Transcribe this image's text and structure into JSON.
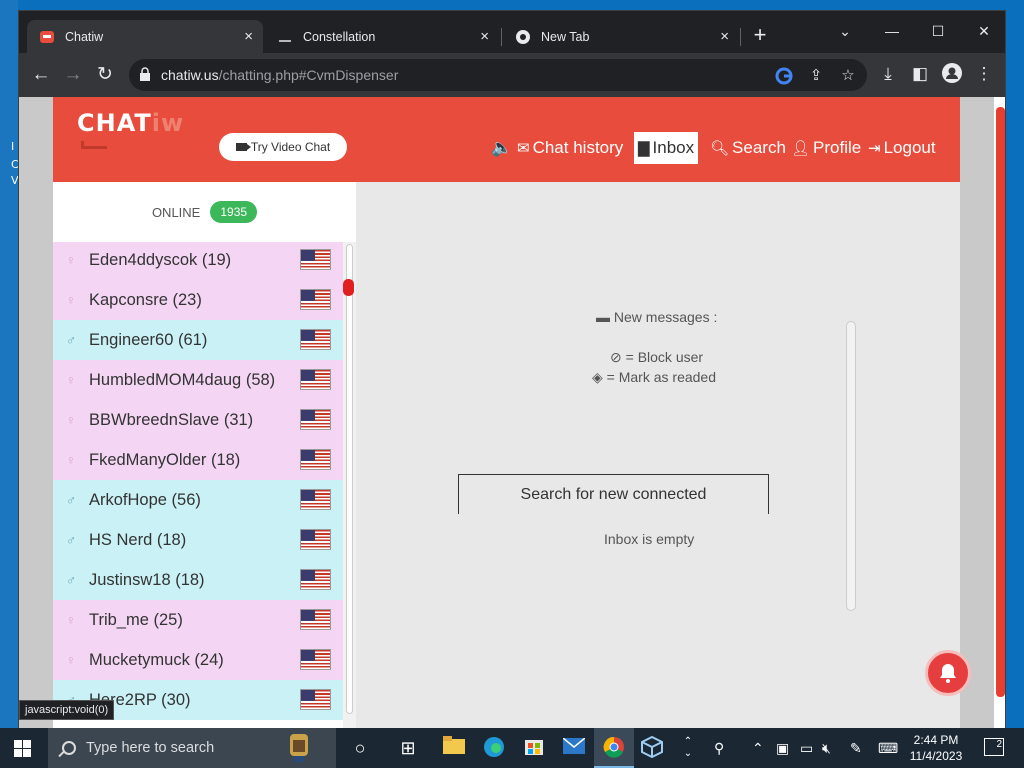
{
  "desktop": {
    "edge_letters": [
      "I",
      "C",
      "V"
    ]
  },
  "browser": {
    "tabs": [
      {
        "title": "Chatiw",
        "close": "×",
        "active": true
      },
      {
        "title": "Constellation",
        "close": "×",
        "active": false
      },
      {
        "title": "New Tab",
        "close": "×",
        "active": false
      }
    ],
    "new_tab": "+",
    "window_controls": {
      "minimize": "—",
      "maximize": "☐",
      "close": "✕",
      "tab_search": "⌄"
    },
    "url_domain": "chatiw.us",
    "url_path": "/chatting.php#CvmDispenser",
    "status_url": "javascript:void(0)"
  },
  "site": {
    "logo_main": "CHAT",
    "logo_tail": "iw",
    "video_chat_label": "Try Video Chat",
    "nav": {
      "mute_icon": "🔈",
      "chat_history": "Chat history",
      "inbox": "Inbox",
      "search": "Search",
      "profile": "Profile",
      "logout": "Logout"
    },
    "online_label": "ONLINE",
    "online_count": "1935",
    "users": [
      {
        "name": "Eden4ddyscok (19)",
        "gender": "female"
      },
      {
        "name": "Kapconsre (23)",
        "gender": "female"
      },
      {
        "name": "Engineer60 (61)",
        "gender": "male"
      },
      {
        "name": "HumbledMOM4daug (58)",
        "gender": "female"
      },
      {
        "name": "BBWbreednSlave (31)",
        "gender": "female"
      },
      {
        "name": "FkedManyOlder (18)",
        "gender": "female"
      },
      {
        "name": "ArkofHope (56)",
        "gender": "male"
      },
      {
        "name": "HS Nerd (18)",
        "gender": "male"
      },
      {
        "name": "Justinsw18 (18)",
        "gender": "male"
      },
      {
        "name": "Trib_me (25)",
        "gender": "female"
      },
      {
        "name": "Mucketymuck (24)",
        "gender": "female"
      },
      {
        "name": "Here2RP (30)",
        "gender": "male"
      }
    ],
    "inbox": {
      "new_messages": "New messages :",
      "block_user": "= Block user",
      "mark_read": "= Mark as readed",
      "empty": "Inbox is empty",
      "search_button": "Search for new connected"
    }
  },
  "taskbar": {
    "search_placeholder": "Type here to search",
    "time": "2:44 PM",
    "date": "11/4/2023",
    "notification_count": "2"
  },
  "colors": {
    "brand_red": "#e74c3c",
    "online_green": "#3cb85a",
    "female_row": "#f4d6f4",
    "male_row": "#c9f1f6"
  }
}
